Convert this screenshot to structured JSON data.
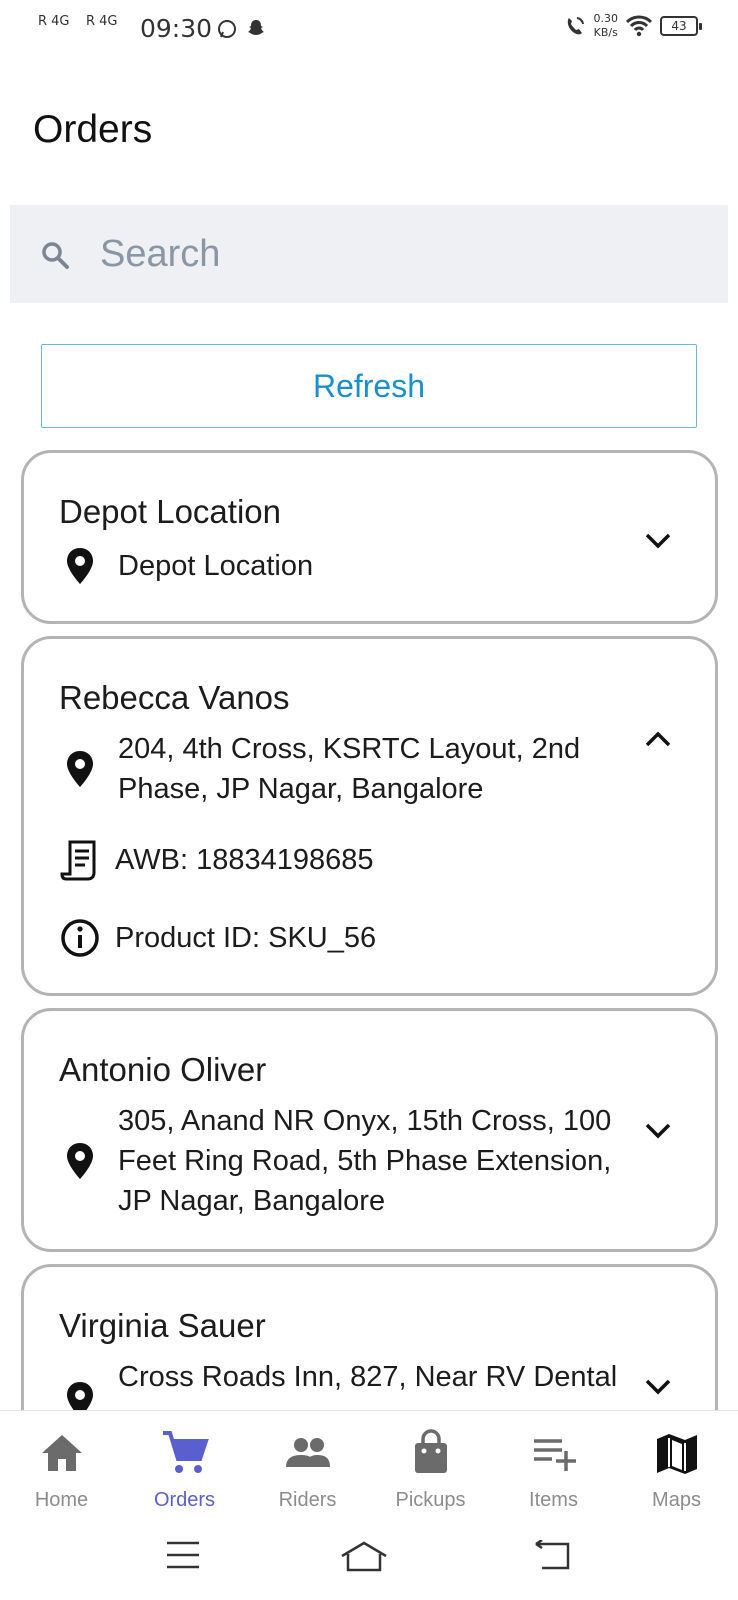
{
  "status_bar": {
    "signal_1": "R 4G",
    "signal_2": "R 4G",
    "time": "09:30",
    "net_speed_value": "0.30",
    "net_speed_unit": "KB/s",
    "battery": "43"
  },
  "header": {
    "title": "Orders"
  },
  "search": {
    "placeholder": "Search"
  },
  "refresh_label": "Refresh",
  "orders": [
    {
      "name": "Depot Location",
      "address": "Depot Location",
      "expanded": false
    },
    {
      "name": "Rebecca Vanos",
      "address_line1": "204, 4th Cross, KSRTC Layout, 2nd",
      "address_line2": "Phase, JP Nagar, Bangalore",
      "awb": "AWB: 18834198685",
      "product": "Product ID: SKU_56",
      "expanded": true
    },
    {
      "name": "Antonio Oliver",
      "address_line1": "305, Anand NR Onyx, 15th Cross, 100",
      "address_line2": "Feet Ring Road, 5th Phase Extension,",
      "address_line3": "JP Nagar, Bangalore",
      "expanded": false
    },
    {
      "name": "Virginia Sauer",
      "address_line1": "Cross Roads Inn, 827, Near RV Dental",
      "expanded": false
    }
  ],
  "bottom_nav": [
    {
      "label": "Home",
      "icon": "home-icon",
      "active": false
    },
    {
      "label": "Orders",
      "icon": "cart-icon",
      "active": true
    },
    {
      "label": "Riders",
      "icon": "people-icon",
      "active": false
    },
    {
      "label": "Pickups",
      "icon": "bag-icon",
      "active": false
    },
    {
      "label": "Items",
      "icon": "playlist-add-icon",
      "active": false
    },
    {
      "label": "Maps",
      "icon": "map-icon",
      "active": false
    }
  ],
  "colors": {
    "accent": "#1a8fce",
    "nav_active": "#5a5fcf",
    "nav_inactive": "#8c8c8c",
    "card_border": "#b4b4b4",
    "search_bg": "#eef0f3"
  }
}
